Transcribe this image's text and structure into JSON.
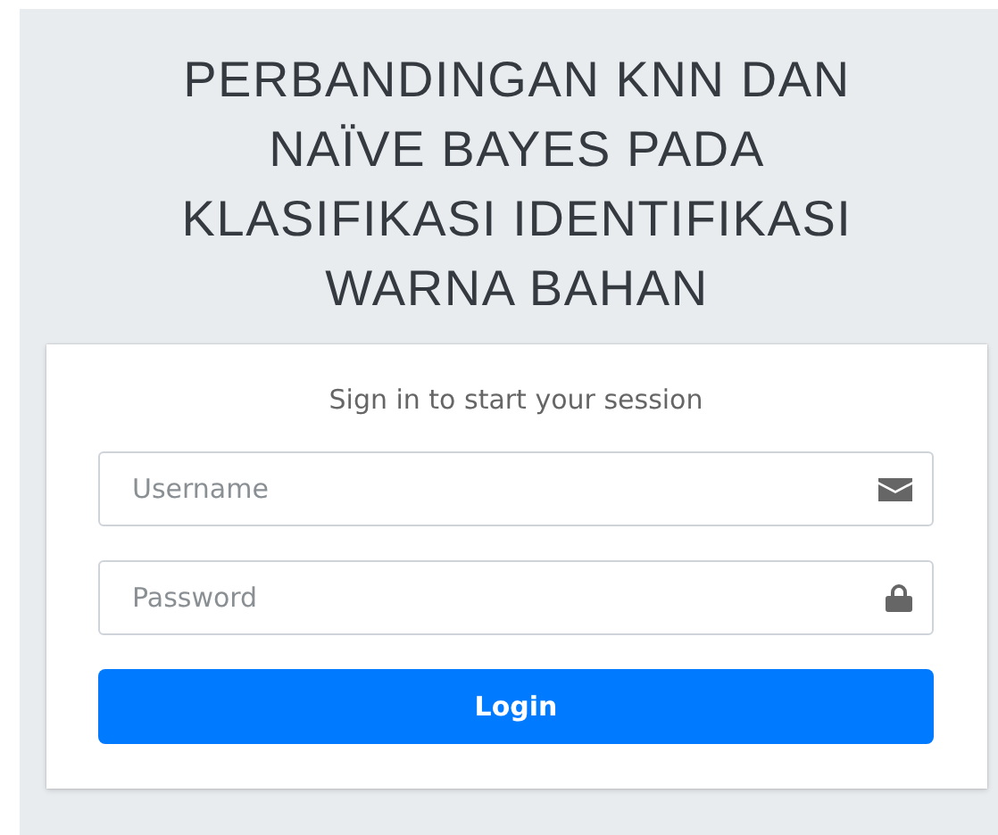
{
  "title": "PERBANDINGAN KNN DAN NAÏVE BAYES PADA KLASIFIKASI IDENTIFIKASI WARNA BAHAN",
  "login_card": {
    "message": "Sign in to start your session",
    "fields": [
      {
        "kind": "text",
        "placeholder": "Username"
      },
      {
        "kind": "password",
        "placeholder": "Password"
      }
    ],
    "button": "Login"
  }
}
